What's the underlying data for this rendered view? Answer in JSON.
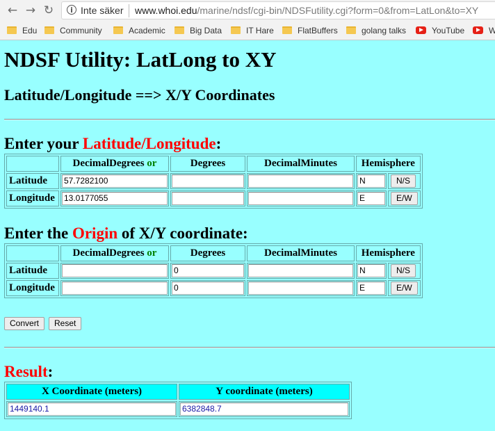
{
  "browser": {
    "security_label": "Inte säker",
    "url_host": "www.whoi.edu",
    "url_path": "/marine/ndsf/cgi-bin/NDSFutility.cgi?form=0&from=LatLon&to=XY",
    "bookmarks": [
      "Edu",
      "Community",
      "Academic",
      "Big Data",
      "IT Hare",
      "FlatBuffers",
      "golang talks",
      "YouTube",
      "W"
    ]
  },
  "page": {
    "title": "NDSF Utility: LatLong to XY",
    "subtitle": "Latitude/Longitude ==> X/Y Coordinates",
    "enter_latlong": {
      "prefix": "Enter your ",
      "highlight": "Latitude/Longitude",
      "suffix": ":"
    },
    "enter_origin": {
      "prefix": "Enter the ",
      "highlight": "Origin",
      "suffix": " of X/Y coordinate:"
    },
    "headers": {
      "decimal_degrees": "DecimalDegrees ",
      "or": "or",
      "degrees": "Degrees",
      "decimal_minutes": "DecimalMinutes",
      "hemisphere": "Hemisphere"
    },
    "latlong_table": {
      "latitude": {
        "label": "Latitude",
        "decimal_degrees": "57.7282100",
        "degrees": "",
        "decimal_minutes": "",
        "hemisphere": "N",
        "button": "N/S"
      },
      "longitude": {
        "label": "Longitude",
        "decimal_degrees": "13.0177055",
        "degrees": "",
        "decimal_minutes": "",
        "hemisphere": "E",
        "button": "E/W"
      }
    },
    "origin_table": {
      "latitude": {
        "label": "Latitude",
        "decimal_degrees": "",
        "degrees": "0",
        "decimal_minutes": "",
        "hemisphere": "N",
        "button": "N/S"
      },
      "longitude": {
        "label": "Longitude",
        "decimal_degrees": "",
        "degrees": "0",
        "decimal_minutes": "",
        "hemisphere": "E",
        "button": "E/W"
      }
    },
    "buttons": {
      "convert": "Convert",
      "reset": "Reset"
    },
    "result": {
      "label": "Result",
      "suffix": ":",
      "x_header": "X Coordinate (meters)",
      "y_header": "Y coordinate (meters)",
      "x_value": "1449140.1",
      "y_value": "6382848.7"
    }
  }
}
